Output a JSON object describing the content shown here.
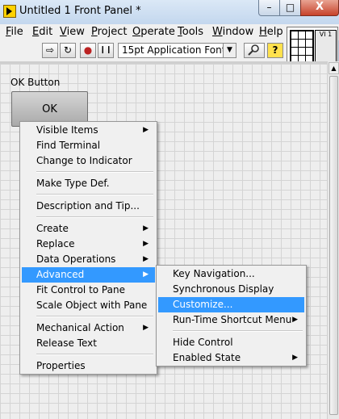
{
  "window": {
    "title": "Untitled 1 Front Panel *",
    "minimize": "–",
    "maximize": "□",
    "close": "X"
  },
  "menubar": [
    "File",
    "Edit",
    "View",
    "Project",
    "Operate",
    "Tools",
    "Window",
    "Help"
  ],
  "toolbar": {
    "font": "15pt Application Font",
    "run": "⇨",
    "run_continuous": "↻",
    "abort": "●",
    "pause": "❙❙",
    "font_arrow": "▼",
    "help": "?"
  },
  "icon_pane": {
    "vi_label": "VI 1"
  },
  "panel": {
    "ok_label": "OK Button",
    "ok_text": "OK"
  },
  "context_menu": [
    {
      "label": "Visible Items",
      "submenu": true
    },
    {
      "label": "Find Terminal"
    },
    {
      "label": "Change to Indicator"
    },
    {
      "sep": true
    },
    {
      "label": "Make Type Def."
    },
    {
      "sep": true
    },
    {
      "label": "Description and Tip..."
    },
    {
      "sep": true
    },
    {
      "label": "Create",
      "submenu": true
    },
    {
      "label": "Replace",
      "submenu": true
    },
    {
      "label": "Data Operations",
      "submenu": true
    },
    {
      "label": "Advanced",
      "submenu": true,
      "highlighted": true
    },
    {
      "label": "Fit Control to Pane"
    },
    {
      "label": "Scale Object with Pane"
    },
    {
      "sep": true
    },
    {
      "label": "Mechanical Action",
      "submenu": true
    },
    {
      "label": "Release Text"
    },
    {
      "sep": true
    },
    {
      "label": "Properties"
    }
  ],
  "advanced_submenu": [
    {
      "label": "Key Navigation..."
    },
    {
      "label": "Synchronous Display"
    },
    {
      "label": "Customize...",
      "highlighted": true
    },
    {
      "label": "Run-Time Shortcut Menu",
      "submenu": true
    },
    {
      "sep": true
    },
    {
      "label": "Hide Control"
    },
    {
      "label": "Enabled State",
      "submenu": true
    }
  ],
  "colors": {
    "highlight": "#3399ff",
    "panel_grid": "#d4d4d4",
    "menu_bg": "#f0f0f0"
  }
}
